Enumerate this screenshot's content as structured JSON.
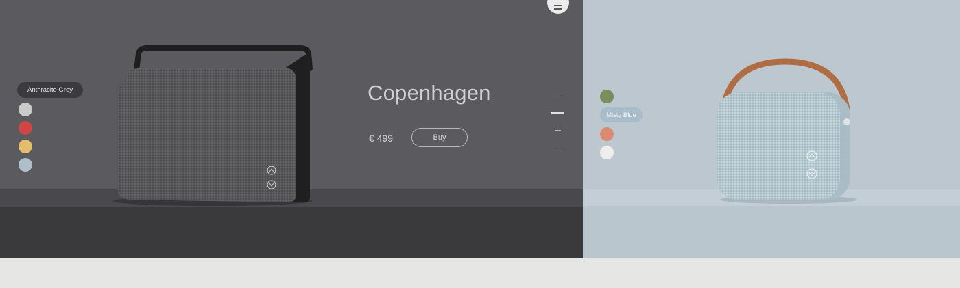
{
  "left_product": {
    "name": "Copenhagen",
    "price": "€ 499",
    "buy_label": "Buy",
    "selected_color": "Anthracite Grey",
    "swatches": [
      "#cbcbcb",
      "#d24545",
      "#e3bd6c",
      "#aebfcb"
    ]
  },
  "right_product": {
    "selected_color": "Misty Blue",
    "swatches_above": [
      "#7a8f5e"
    ],
    "swatches_below": [
      "#dc8a72",
      "#eeeeee"
    ]
  },
  "menu": {
    "icon": "hamburger-icon"
  },
  "pager": {
    "count": 4,
    "active_index": 1
  },
  "colors": {
    "left_bg": "#5b5b5f",
    "right_bg": "#bcc7cf",
    "footer_bg": "#e6e6e4"
  }
}
